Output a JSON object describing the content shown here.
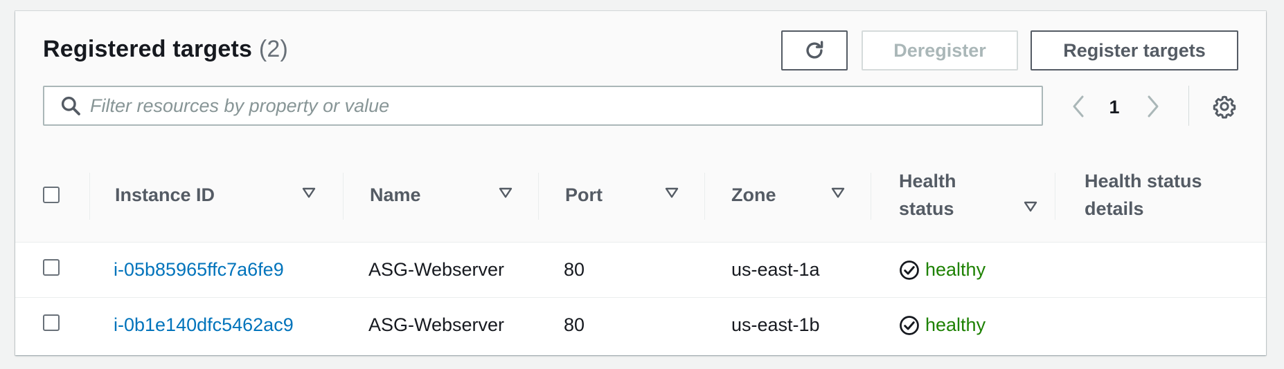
{
  "panel": {
    "title": "Registered targets",
    "count": "(2)"
  },
  "actions": {
    "refresh_icon": "refresh-icon",
    "deregister_label": "Deregister",
    "register_label": "Register targets"
  },
  "filter": {
    "placeholder": "Filter resources by property or value",
    "value": ""
  },
  "pagination": {
    "current_page": "1"
  },
  "table": {
    "columns": [
      "Instance ID",
      "Name",
      "Port",
      "Zone",
      "Health status",
      "Health status details"
    ],
    "rows": [
      {
        "instance_id": "i-05b85965ffc7a6fe9",
        "name": "ASG-Webserver",
        "port": "80",
        "zone": "us-east-1a",
        "health": "healthy",
        "details": ""
      },
      {
        "instance_id": "i-0b1e140dfc5462ac9",
        "name": "ASG-Webserver",
        "port": "80",
        "zone": "us-east-1b",
        "health": "healthy",
        "details": ""
      }
    ]
  },
  "colors": {
    "link": "#0073bb",
    "healthy": "#1d8102",
    "disabled": "#aab7b8"
  }
}
